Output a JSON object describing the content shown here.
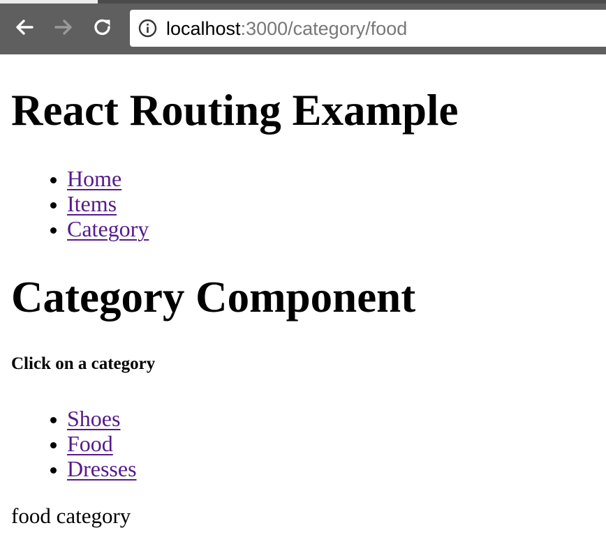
{
  "browser": {
    "url_host": "localhost",
    "url_rest": ":3000/category/food",
    "icons": {
      "back": "arrow-left-icon",
      "forward": "arrow-right-icon",
      "reload": "reload-icon",
      "site_info": "info-icon"
    }
  },
  "page": {
    "title": "React Routing Example",
    "nav_links": [
      {
        "label": "Home"
      },
      {
        "label": "Items"
      },
      {
        "label": "Category"
      }
    ],
    "component_title": "Category Component",
    "instruction": "Click on a category",
    "category_links": [
      {
        "label": "Shoes"
      },
      {
        "label": "Food"
      },
      {
        "label": "Dresses"
      }
    ],
    "result": "food category"
  },
  "colors": {
    "chrome_bg": "#5f5f5f",
    "visited_link": "#551a8b",
    "url_host": "#000000",
    "url_rest": "#777777"
  }
}
